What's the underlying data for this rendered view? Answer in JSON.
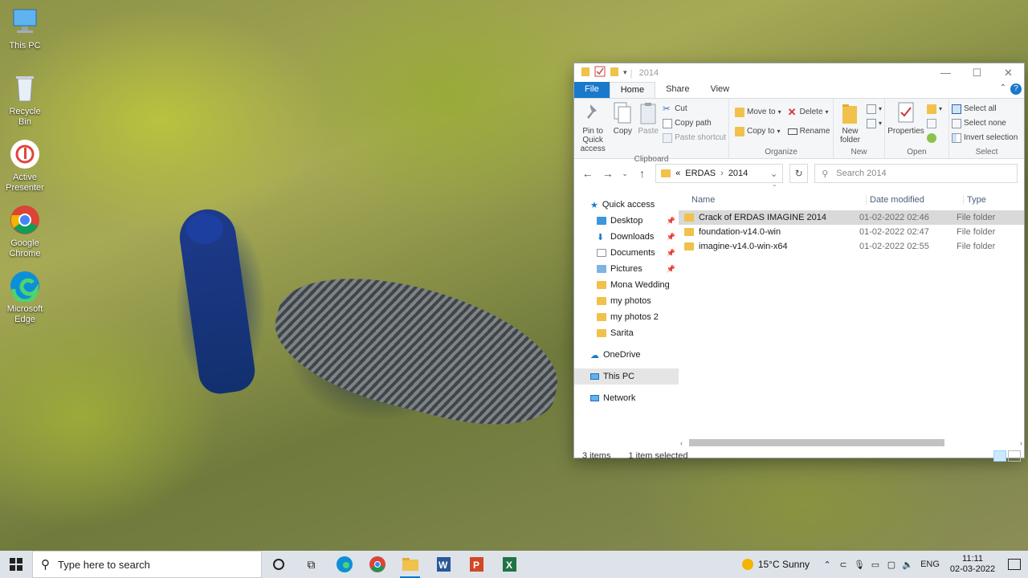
{
  "desktop": {
    "icons": [
      {
        "label": "This PC"
      },
      {
        "label": "Recycle Bin"
      },
      {
        "label": "Active Presenter"
      },
      {
        "label": "Google Chrome"
      },
      {
        "label": "Microsoft Edge"
      }
    ]
  },
  "explorer": {
    "title": "2014",
    "ribbon_tabs": [
      "File",
      "Home",
      "Share",
      "View"
    ],
    "help": "?",
    "ribbon": {
      "clipboard": {
        "pin_label": "Pin to Quick access",
        "copy_label": "Copy",
        "paste_label": "Paste",
        "cut_label": "Cut",
        "copy_path_label": "Copy path",
        "paste_shortcut_label": "Paste shortcut",
        "group_label": "Clipboard"
      },
      "organize": {
        "move_to_label": "Move to",
        "copy_to_label": "Copy to",
        "delete_label": "Delete",
        "rename_label": "Rename",
        "group_label": "Organize"
      },
      "new": {
        "new_folder_label": "New folder",
        "group_label": "New"
      },
      "open": {
        "properties_label": "Properties",
        "group_label": "Open"
      },
      "select": {
        "select_all_label": "Select all",
        "select_none_label": "Select none",
        "invert_label": "Invert selection",
        "group_label": "Select"
      }
    },
    "address": {
      "prefix": "«",
      "crumbs": [
        "ERDAS",
        "2014"
      ]
    },
    "search": {
      "placeholder": "Search 2014"
    },
    "nav_pane": {
      "quick_access": "Quick access",
      "quick_items": [
        {
          "label": "Desktop",
          "pinned": true
        },
        {
          "label": "Downloads",
          "pinned": true
        },
        {
          "label": "Documents",
          "pinned": true
        },
        {
          "label": "Pictures",
          "pinned": true
        },
        {
          "label": "Mona Wedding",
          "pinned": false
        },
        {
          "label": "my photos",
          "pinned": false
        },
        {
          "label": "my photos 2",
          "pinned": false
        },
        {
          "label": "Sarita",
          "pinned": false
        }
      ],
      "onedrive": "OneDrive",
      "this_pc": "This PC",
      "network": "Network"
    },
    "columns": [
      "Name",
      "Date modified",
      "Type"
    ],
    "files": [
      {
        "name": "Crack of ERDAS IMAGINE 2014",
        "date": "01-02-2022 02:46",
        "type": "File folder",
        "selected": true
      },
      {
        "name": "foundation-v14.0-win",
        "date": "01-02-2022 02:47",
        "type": "File folder",
        "selected": false
      },
      {
        "name": "imagine-v14.0-win-x64",
        "date": "01-02-2022 02:55",
        "type": "File folder",
        "selected": false
      }
    ],
    "status": {
      "items": "3 items",
      "selected": "1 item selected"
    }
  },
  "taskbar": {
    "search_placeholder": "Type here to search",
    "weather": "15°C  Sunny",
    "lang": "ENG",
    "time": "11:11",
    "date": "02-03-2022"
  },
  "colors": {
    "accent": "#1979ca",
    "folder": "#f0c14b",
    "taskbar": "#dde3e9"
  }
}
